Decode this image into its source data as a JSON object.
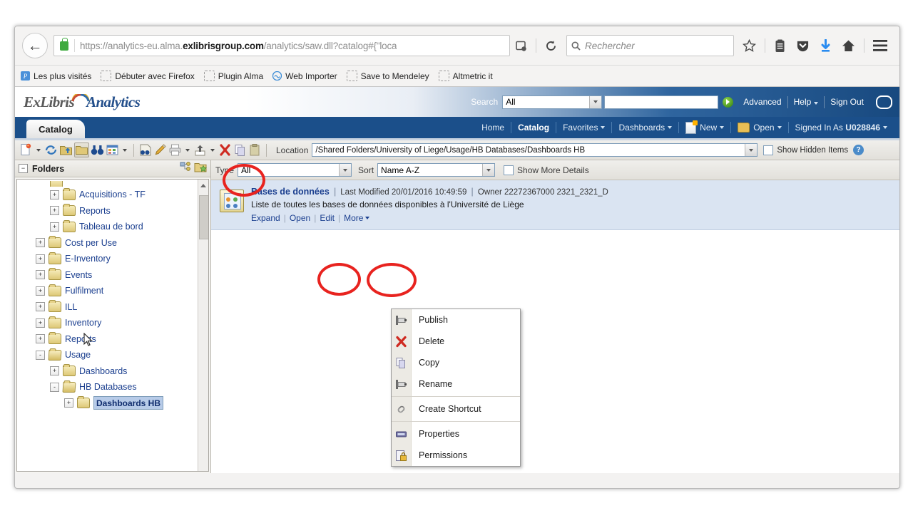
{
  "browser": {
    "url_prefix": "https://analytics-eu.alma.",
    "url_bold": "exlibrisgroup.com",
    "url_suffix": "/analytics/saw.dll?catalog#{\"loca",
    "search_placeholder": "Rechercher",
    "back_icon": "back-arrow-icon",
    "lock_icon": "padlock-icon",
    "reader_icon": "reader-view-icon",
    "reload_icon": "reload-icon",
    "bookmark_star_icon": "star-icon",
    "library_icon": "library-icon",
    "pocket_icon": "pocket-icon",
    "download_icon": "download-arrow-icon",
    "home_icon": "home-icon",
    "menu_icon": "hamburger-menu-icon"
  },
  "bookmarks": [
    {
      "label": "Les plus visités",
      "icon": "most-visited-icon"
    },
    {
      "label": "Débuter avec Firefox",
      "icon": "blank-bookmark-icon"
    },
    {
      "label": "Plugin Alma",
      "icon": "blank-bookmark-icon"
    },
    {
      "label": "Web Importer",
      "icon": "mendeley-circle-icon"
    },
    {
      "label": "Save to Mendeley",
      "icon": "blank-bookmark-icon"
    },
    {
      "label": "Altmetric it",
      "icon": "blank-bookmark-icon"
    }
  ],
  "app_header": {
    "logo_ex": "ExLibris",
    "logo_analytics": "Analytics",
    "search_label": "Search",
    "search_scope": "All",
    "search_value": "",
    "go_icon": "go-arrow-icon",
    "advanced": "Advanced",
    "help": "Help",
    "sign_out": "Sign Out",
    "chat_icon": "chat-bubble-icon"
  },
  "tabbar": {
    "tab_label": "Catalog",
    "nav": [
      {
        "label": "Home",
        "active": false,
        "caret": false,
        "icon": ""
      },
      {
        "label": "Catalog",
        "active": true,
        "caret": false,
        "icon": ""
      },
      {
        "label": "Favorites",
        "active": false,
        "caret": true,
        "icon": ""
      },
      {
        "label": "Dashboards",
        "active": false,
        "caret": true,
        "icon": ""
      },
      {
        "label": "New",
        "active": false,
        "caret": true,
        "icon": "new-document-icon"
      },
      {
        "label": "Open",
        "active": false,
        "caret": true,
        "icon": "open-folder-icon"
      },
      {
        "label": "Signed In As",
        "value": "U028846",
        "active": false,
        "caret": true,
        "icon": ""
      }
    ]
  },
  "toolbar": {
    "location_label": "Location",
    "location_value": "/Shared Folders/University of Liege/Usage/HB Databases/Dashboards HB",
    "show_hidden_label": "Show Hidden Items",
    "show_hidden_checked": false,
    "help_icon": "help-question-icon",
    "icons": [
      "new-item-icon",
      "refresh-icon",
      "upload-folder-icon",
      "open-folder-icon",
      "search-binoculars-icon",
      "preferences-icon",
      "archive-icon",
      "edit-pencil-icon",
      "print-icon",
      "export-upload-icon",
      "delete-x-icon",
      "copy-icon",
      "paste-icon"
    ]
  },
  "filterbar": {
    "type_label": "Type",
    "type_value": "All",
    "sort_label": "Sort",
    "sort_value": "Name A-Z",
    "more_details_label": "Show More Details",
    "more_details_checked": false
  },
  "sidebar": {
    "title": "Folders",
    "collapse_icon": "collapse-minus-icon",
    "header_icons": [
      "tree-nodes-icon",
      "new-folder-icon"
    ],
    "scroll_up_icon": "scroll-up-arrow-icon",
    "tree": [
      {
        "label": "Acquisitions - TF",
        "indent": 2,
        "expander": "+",
        "open": false,
        "selected": false
      },
      {
        "label": "Reports",
        "indent": 2,
        "expander": "+",
        "open": false,
        "selected": false
      },
      {
        "label": "Tableau de bord",
        "indent": 2,
        "expander": "+",
        "open": false,
        "selected": false
      },
      {
        "label": "Cost per Use",
        "indent": 1,
        "expander": "+",
        "open": false,
        "selected": false
      },
      {
        "label": "E-Inventory",
        "indent": 1,
        "expander": "+",
        "open": false,
        "selected": false
      },
      {
        "label": "Events",
        "indent": 1,
        "expander": "+",
        "open": false,
        "selected": false
      },
      {
        "label": "Fulfilment",
        "indent": 1,
        "expander": "+",
        "open": false,
        "selected": false
      },
      {
        "label": "ILL",
        "indent": 1,
        "expander": "+",
        "open": false,
        "selected": false
      },
      {
        "label": "Inventory",
        "indent": 1,
        "expander": "+",
        "open": false,
        "selected": false
      },
      {
        "label": "Reports",
        "indent": 1,
        "expander": "+",
        "open": false,
        "selected": false
      },
      {
        "label": "Usage",
        "indent": 1,
        "expander": "-",
        "open": true,
        "selected": false
      },
      {
        "label": "Dashboards",
        "indent": 2,
        "expander": "+",
        "open": false,
        "selected": false
      },
      {
        "label": "HB Databases",
        "indent": 2,
        "expander": "-",
        "open": true,
        "selected": false
      },
      {
        "label": "Dashboards HB",
        "indent": 3,
        "expander": "+",
        "open": false,
        "selected": true
      }
    ]
  },
  "item": {
    "icon": "dashboard-item-icon",
    "title": "Bases de données",
    "modified_label": "Last Modified",
    "modified_value": "20/01/2016 10:49:59",
    "owner_label": "Owner",
    "owner_value": "22272367000 2321_2321_D",
    "description": "Liste de toutes les bases de données disponibles à l'Université de Liège",
    "links": [
      "Expand",
      "Open",
      "Edit",
      "More"
    ]
  },
  "context_menu": {
    "items": [
      {
        "label": "Publish",
        "icon": "publish-icon",
        "group": 1
      },
      {
        "label": "Delete",
        "icon": "delete-x-icon",
        "group": 1
      },
      {
        "label": "Copy",
        "icon": "copy-icon",
        "group": 1
      },
      {
        "label": "Rename",
        "icon": "rename-icon",
        "group": 1
      },
      {
        "label": "Create Shortcut",
        "icon": "shortcut-link-icon",
        "group": 2
      },
      {
        "label": "Properties",
        "icon": "properties-icon",
        "group": 3
      },
      {
        "label": "Permissions",
        "icon": "permissions-lock-icon",
        "group": 3
      }
    ]
  },
  "annotations": {
    "circle_color": "#e8231f",
    "circles": [
      "toolbar-export-button",
      "open-link",
      "more-link"
    ]
  }
}
